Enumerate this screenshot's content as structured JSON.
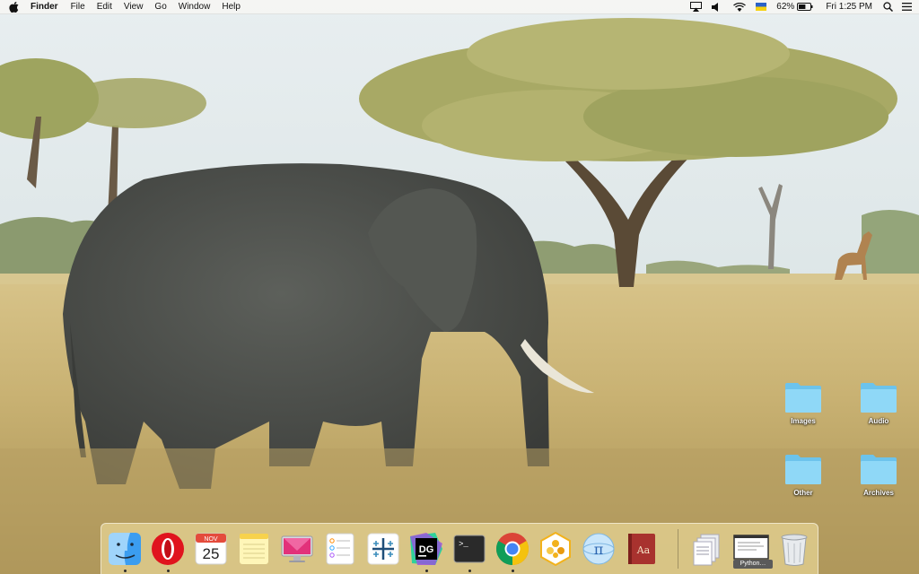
{
  "menubar": {
    "apple_icon": "apple-logo-icon",
    "app_name": "Finder",
    "menus": [
      "File",
      "Edit",
      "View",
      "Go",
      "Window",
      "Help"
    ],
    "status": {
      "airplay_icon": "airplay-icon",
      "volume_icon": "volume-icon",
      "wifi_icon": "wifi-icon",
      "input_source_icon": "ukrainian-flag-icon",
      "battery_percent": "62%",
      "battery_level": 0.62,
      "clock": "Fri 1:25 PM",
      "spotlight_icon": "search-icon",
      "notification_icon": "list-icon"
    }
  },
  "desktop": {
    "folders": [
      {
        "label": "Images"
      },
      {
        "label": "Audio"
      },
      {
        "label": "Other"
      },
      {
        "label": "Archives"
      }
    ],
    "folder_color": "#7ecff0"
  },
  "dock": {
    "apps": [
      {
        "name": "Finder",
        "icon": "finder-icon",
        "running": true
      },
      {
        "name": "Opera",
        "icon": "opera-icon",
        "running": true
      },
      {
        "name": "Calendar",
        "icon": "calendar-icon",
        "running": false,
        "month": "NOV",
        "day": "25"
      },
      {
        "name": "Notes",
        "icon": "notes-icon",
        "running": false
      },
      {
        "name": "CleanMyMac",
        "icon": "cleanmymac-icon",
        "running": false
      },
      {
        "name": "Reminders",
        "icon": "reminders-icon",
        "running": false
      },
      {
        "name": "Tableau",
        "icon": "tableau-icon",
        "running": false
      },
      {
        "name": "DataGrip",
        "icon": "datagrip-icon",
        "running": true,
        "text": "DG"
      },
      {
        "name": "Terminal",
        "icon": "terminal-icon",
        "running": true,
        "text": ">_"
      },
      {
        "name": "Chrome",
        "icon": "chrome-icon",
        "running": true
      },
      {
        "name": "Slack-like",
        "icon": "flower-icon",
        "running": false
      },
      {
        "name": "Pi",
        "icon": "pi-sphere-icon",
        "running": false
      },
      {
        "name": "Dictionary",
        "icon": "dictionary-icon",
        "running": false,
        "text": "Aa"
      }
    ],
    "stacks": [
      {
        "name": "Documents stack",
        "icon": "documents-stack-icon"
      },
      {
        "name": "Python…",
        "icon": "python-window-icon",
        "label": "Python…"
      },
      {
        "name": "Trash",
        "icon": "trash-icon"
      }
    ]
  }
}
